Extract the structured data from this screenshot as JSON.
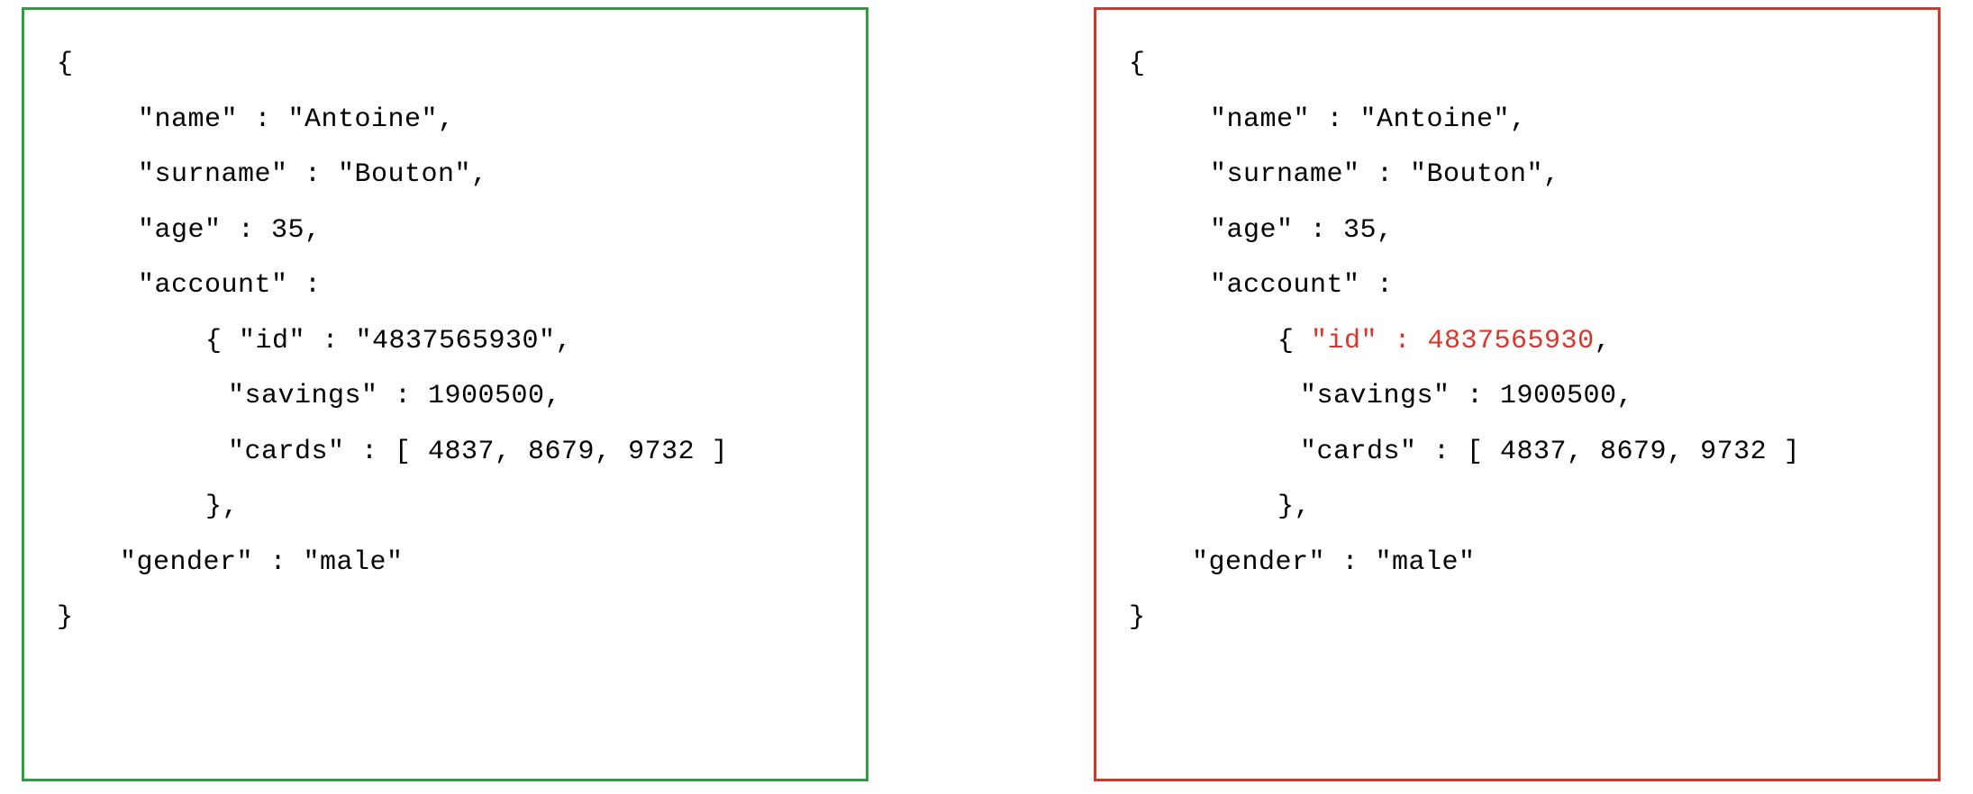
{
  "left": {
    "border_color": "green",
    "lines": {
      "open": "{",
      "name": "\"name\" : \"Antoine\",",
      "surname": "\"surname\" : \"Bouton\",",
      "age": "\"age\" : 35,",
      "account": "\"account\" :",
      "acc_open_id": "{ \"id\" : \"4837565930\",",
      "savings": "\"savings\" : 1900500,",
      "cards": "\"cards\" : [ 4837, 8679, 9732 ]",
      "acc_close": "},",
      "gender": "\"gender\" : \"male\"",
      "close": "}"
    }
  },
  "right": {
    "border_color": "red",
    "lines": {
      "open": "{",
      "name": "\"name\" : \"Antoine\",",
      "surname": "\"surname\" : \"Bouton\",",
      "age": "\"age\" : 35,",
      "account": "\"account\" :",
      "acc_open_brace": "{ ",
      "acc_id_highlight": "\"id\" : 4837565930",
      "acc_id_tail": ",",
      "savings": "\"savings\" : 1900500,",
      "cards": "\"cards\" : [ 4837, 8679, 9732 ]",
      "acc_close": "},",
      "gender": "\"gender\" : \"male\"",
      "close": "}"
    }
  },
  "chart_data": {
    "type": "table",
    "description": "Two JSON documents side by side. Left (green border) is valid: account.id is a string \"4837565930\". Right (red border) has account.id as a raw number 4837565930, highlighted in red to indicate a type error or schema violation.",
    "left_document": {
      "name": "Antoine",
      "surname": "Bouton",
      "age": 35,
      "account": {
        "id": "4837565930",
        "savings": 1900500,
        "cards": [
          4837,
          8679,
          9732
        ]
      },
      "gender": "male"
    },
    "right_document": {
      "name": "Antoine",
      "surname": "Bouton",
      "age": 35,
      "account": {
        "id": 4837565930,
        "savings": 1900500,
        "cards": [
          4837,
          8679,
          9732
        ]
      },
      "gender": "male"
    },
    "difference": "account.id is a quoted string on the left and an unquoted number on the right (highlighted red)."
  }
}
